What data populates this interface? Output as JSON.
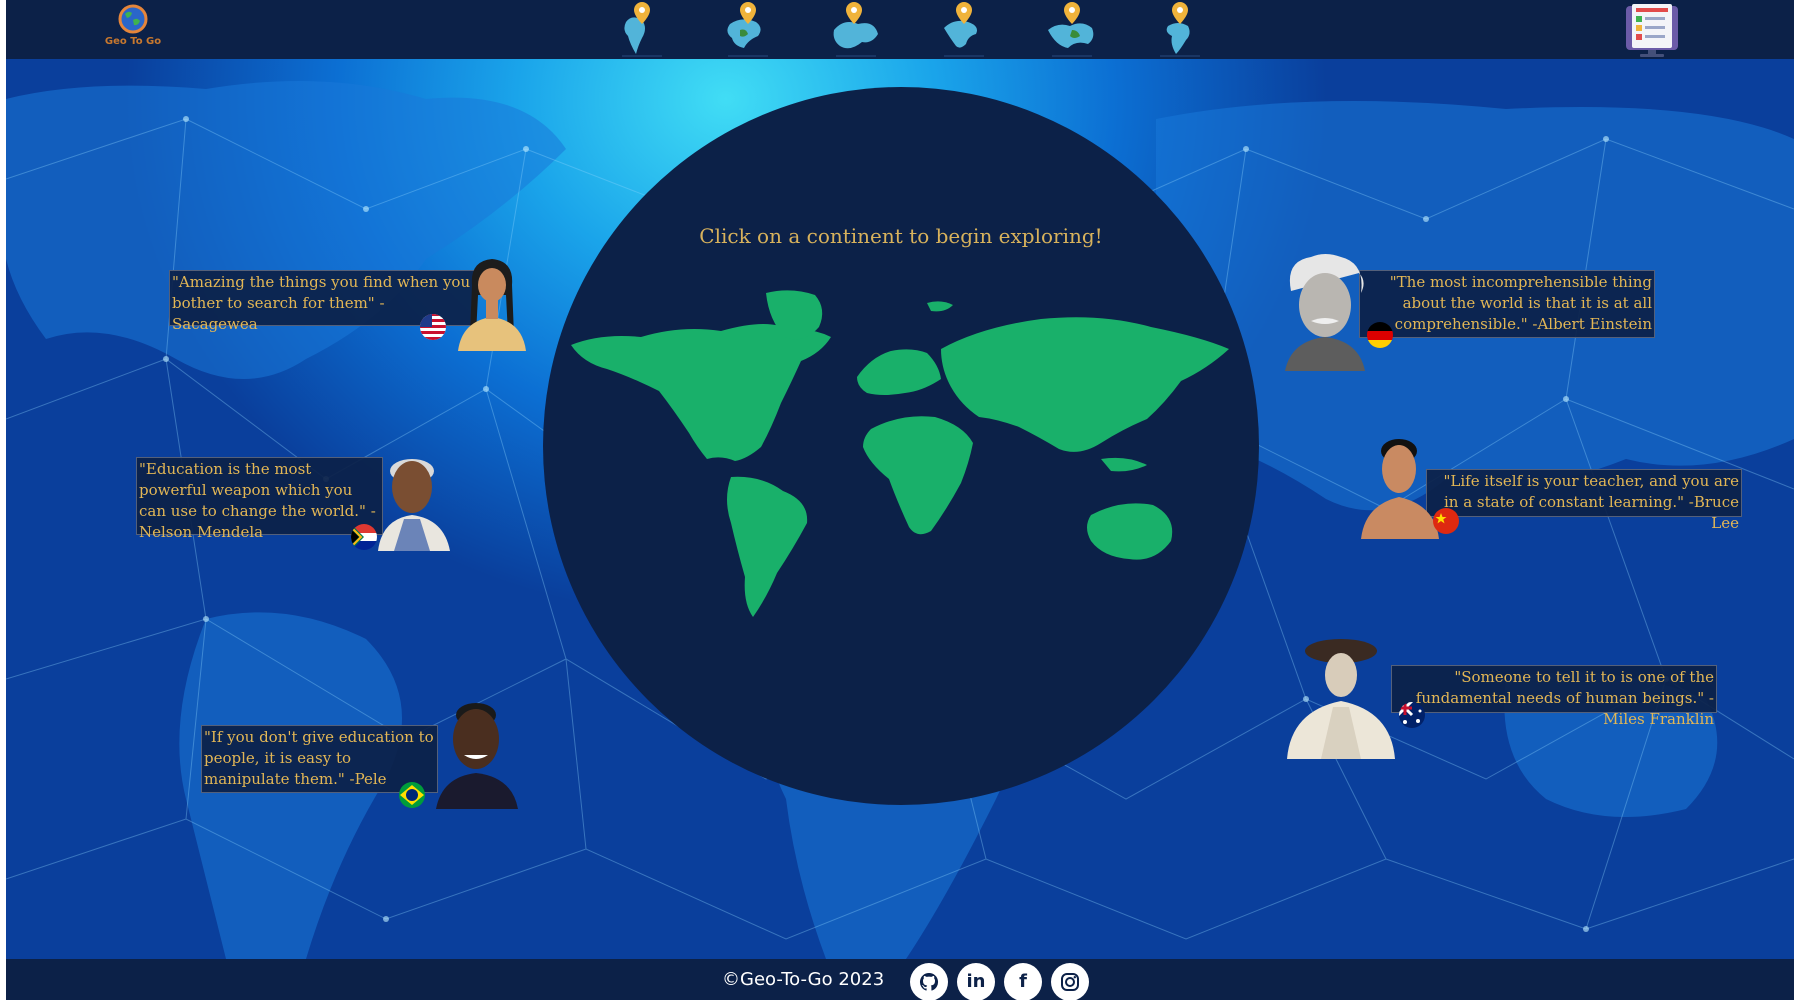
{
  "header": {
    "logo_text": "Geo To Go",
    "nav": [
      {
        "icon": "north-america-map-pin-icon"
      },
      {
        "icon": "south-america-map-pin-icon"
      },
      {
        "icon": "europe-map-pin-icon"
      },
      {
        "icon": "africa-map-pin-icon"
      },
      {
        "icon": "asia-map-pin-icon"
      },
      {
        "icon": "oceania-map-pin-icon"
      }
    ],
    "right_icon": "list-document-icon"
  },
  "main": {
    "prompt": "Click on a continent to begin exploring!"
  },
  "quotes": [
    {
      "text": "\"Amazing the things you find when you bother to search for them\" - Sacagewea",
      "flag": "usa-flag-icon",
      "person": "sacagewea-portrait"
    },
    {
      "text": "\"Education is the most powerful weapon which you can use to change the world.\" -Nelson Mendela",
      "flag": "south-africa-flag-icon",
      "person": "nelson-mandela-portrait"
    },
    {
      "text": "\"If you don't give education to people, it is easy to manipulate them.\" -Pele",
      "flag": "brazil-flag-icon",
      "person": "pele-portrait"
    },
    {
      "text": "\"The most incomprehensible thing about the world is that it is at all comprehensible.\" -Albert Einstein",
      "flag": "germany-flag-icon",
      "person": "albert-einstein-portrait"
    },
    {
      "text": "\"Life itself is your teacher, and you are in a state of constant learning.\" -Bruce Lee",
      "flag": "china-flag-icon",
      "person": "bruce-lee-portrait"
    },
    {
      "text": "\"Someone to tell it to is one of the fundamental needs of human beings.\" -Miles Franklin",
      "flag": "australia-flag-icon",
      "person": "miles-franklin-portrait"
    }
  ],
  "footer": {
    "copyright": "©Geo-To-Go 2023",
    "social": [
      {
        "icon": "github-icon"
      },
      {
        "icon": "linkedin-icon",
        "label": "in"
      },
      {
        "icon": "facebook-icon",
        "label": "f"
      },
      {
        "icon": "instagram-icon"
      }
    ]
  },
  "colors": {
    "navy": "#0c2148",
    "land_green": "#19b06a",
    "quote_gold": "#e2b655",
    "prompt_gold": "#d8b25c"
  }
}
